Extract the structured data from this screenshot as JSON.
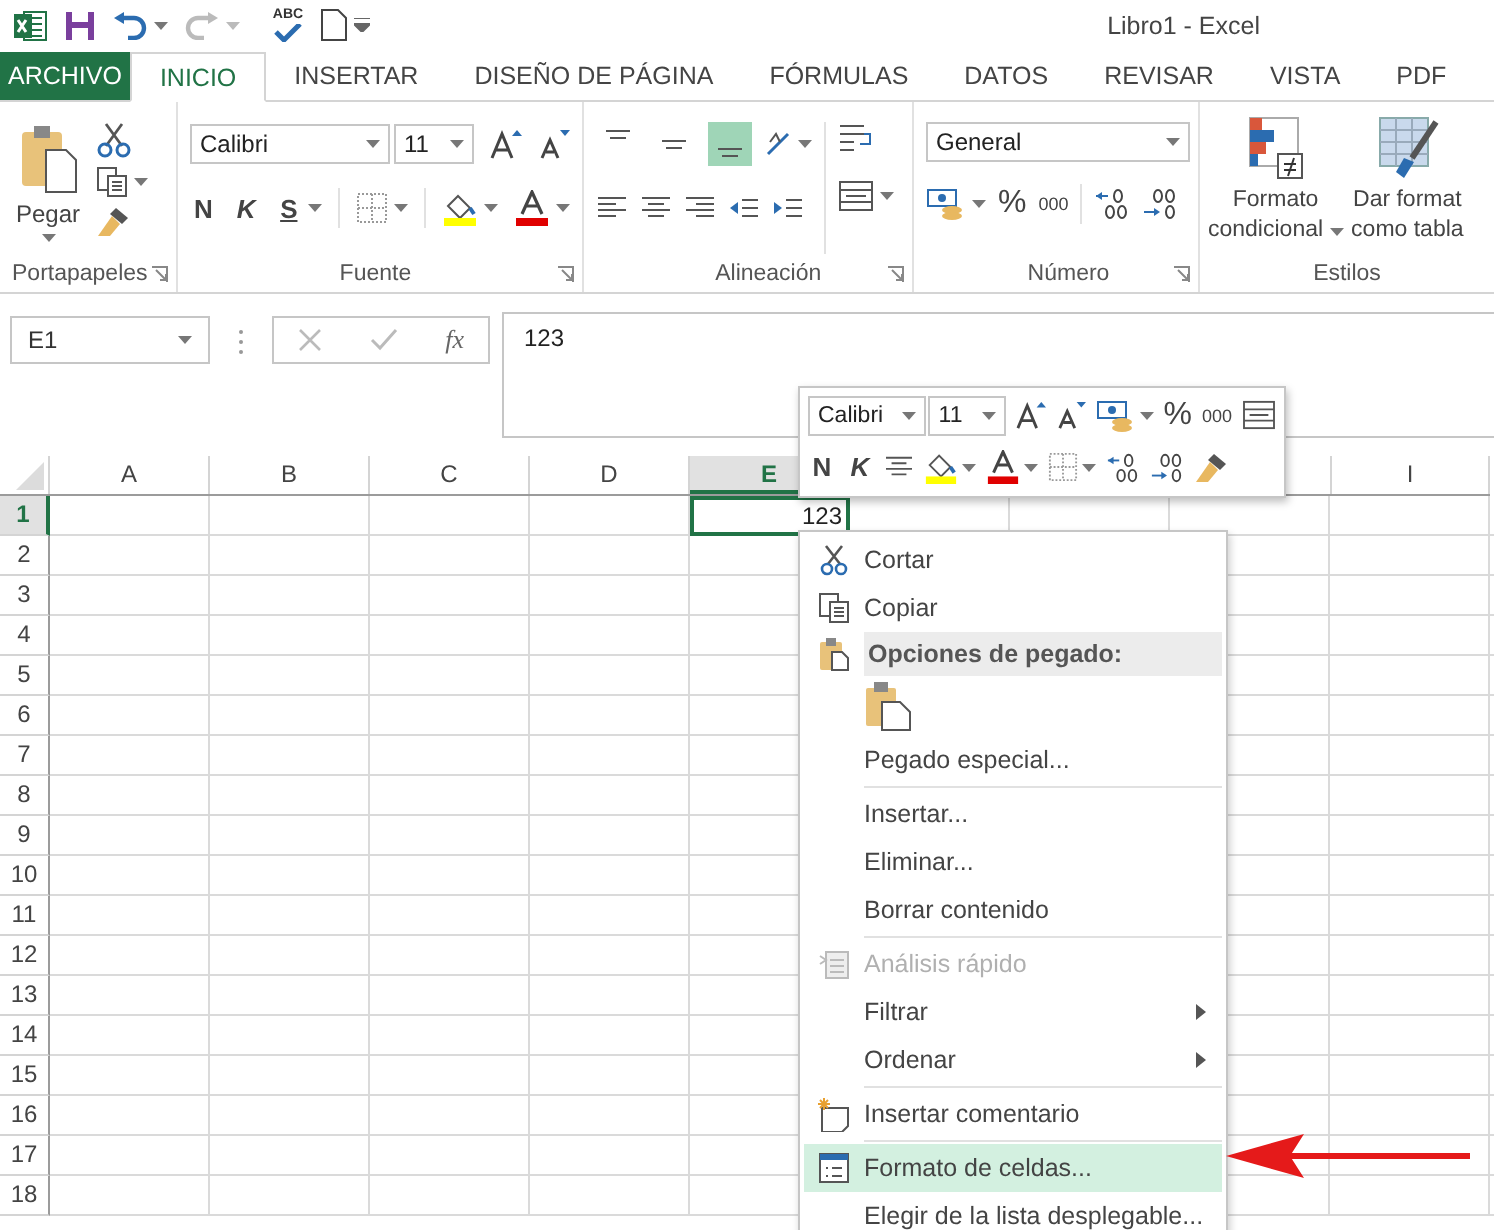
{
  "window": {
    "title": "Libro1 - Excel"
  },
  "quick_access": {
    "spelling_label": "ABC"
  },
  "tabs": [
    {
      "label": "ARCHIVO",
      "kind": "file",
      "selected": false
    },
    {
      "label": "INICIO",
      "kind": "tab",
      "selected": true
    },
    {
      "label": "INSERTAR",
      "kind": "tab",
      "selected": false
    },
    {
      "label": "DISEÑO DE PÁGINA",
      "kind": "tab",
      "selected": false
    },
    {
      "label": "FÓRMULAS",
      "kind": "tab",
      "selected": false
    },
    {
      "label": "DATOS",
      "kind": "tab",
      "selected": false
    },
    {
      "label": "REVISAR",
      "kind": "tab",
      "selected": false
    },
    {
      "label": "VISTA",
      "kind": "tab",
      "selected": false
    },
    {
      "label": "PDF",
      "kind": "tab",
      "selected": false
    }
  ],
  "ribbon": {
    "clipboard": {
      "paste_label": "Pegar",
      "group_label": "Portapapeles"
    },
    "font": {
      "font_name": "Calibri",
      "font_size": "11",
      "bold_label": "N",
      "italic_label": "K",
      "underline_label": "S",
      "group_label": "Fuente"
    },
    "alignment": {
      "vertical": [
        {
          "selected": false
        },
        {
          "selected": false
        },
        {
          "selected": true
        }
      ],
      "group_label": "Alineación"
    },
    "number": {
      "format": "General",
      "percent_label": "%",
      "thousands_label": "000",
      "group_label": "Número"
    },
    "styles": {
      "buttons": [
        {
          "kind": "conditional",
          "lines": [
            "Formato",
            "condicional"
          ],
          "dropdown": true
        },
        {
          "kind": "table",
          "lines": [
            "Dar format",
            "como tabla"
          ],
          "dropdown": false
        }
      ],
      "group_label": "Estilos"
    }
  },
  "formula_bar": {
    "name_box": "E1",
    "function_label": "fx",
    "formula": "123"
  },
  "grid": {
    "columns": [
      {
        "label": "A",
        "selected": false
      },
      {
        "label": "B",
        "selected": false
      },
      {
        "label": "C",
        "selected": false
      },
      {
        "label": "D",
        "selected": false
      },
      {
        "label": "E",
        "selected": true
      },
      {
        "label": "I",
        "selected": false
      }
    ],
    "rows": [
      {
        "label": "1",
        "selected": true
      },
      {
        "label": "2",
        "selected": false
      },
      {
        "label": "3",
        "selected": false
      },
      {
        "label": "4",
        "selected": false
      },
      {
        "label": "5",
        "selected": false
      },
      {
        "label": "6",
        "selected": false
      },
      {
        "label": "7",
        "selected": false
      },
      {
        "label": "8",
        "selected": false
      },
      {
        "label": "9",
        "selected": false
      },
      {
        "label": "10",
        "selected": false
      },
      {
        "label": "11",
        "selected": false
      },
      {
        "label": "12",
        "selected": false
      },
      {
        "label": "13",
        "selected": false
      },
      {
        "label": "14",
        "selected": false
      },
      {
        "label": "15",
        "selected": false
      },
      {
        "label": "16",
        "selected": false
      },
      {
        "label": "17",
        "selected": false
      },
      {
        "label": "18",
        "selected": false
      }
    ],
    "active_value": "123"
  },
  "mini_toolbar": {
    "font_name": "Calibri",
    "font_size": "11",
    "percent_label": "%",
    "thousands_label": "000",
    "bold_label": "N",
    "italic_label": "K"
  },
  "context_menu": {
    "items": [
      {
        "kind": "cut",
        "label": "Cortar",
        "selected": false,
        "disabled": false,
        "submenu": false
      },
      {
        "kind": "copy",
        "label": "Copiar",
        "selected": false,
        "disabled": false,
        "submenu": false
      },
      {
        "kind": "header",
        "label": "Opciones de pegado:"
      },
      {
        "kind": "paste-options"
      },
      {
        "kind": "plain",
        "label": "Pegado especial...",
        "selected": false,
        "disabled": false,
        "submenu": false
      },
      {
        "kind": "separator"
      },
      {
        "kind": "plain",
        "label": "Insertar...",
        "selected": false,
        "disabled": false,
        "submenu": false
      },
      {
        "kind": "plain",
        "label": "Eliminar...",
        "selected": false,
        "disabled": false,
        "submenu": false
      },
      {
        "kind": "plain",
        "label": "Borrar contenido",
        "selected": false,
        "disabled": false,
        "submenu": false
      },
      {
        "kind": "separator"
      },
      {
        "kind": "quick-analysis",
        "label": "Análisis rápido",
        "selected": false,
        "disabled": true,
        "submenu": false
      },
      {
        "kind": "plain",
        "label": "Filtrar",
        "selected": false,
        "disabled": false,
        "submenu": true
      },
      {
        "kind": "plain",
        "label": "Ordenar",
        "selected": false,
        "disabled": false,
        "submenu": true
      },
      {
        "kind": "separator"
      },
      {
        "kind": "comment",
        "label": "Insertar comentario",
        "selected": false,
        "disabled": false,
        "submenu": false
      },
      {
        "kind": "separator"
      },
      {
        "kind": "format",
        "label": "Formato de celdas...",
        "selected": true,
        "disabled": false,
        "submenu": false
      },
      {
        "kind": "plain",
        "label": "Elegir de la lista desplegable...",
        "selected": false,
        "disabled": false,
        "submenu": false
      }
    ]
  }
}
